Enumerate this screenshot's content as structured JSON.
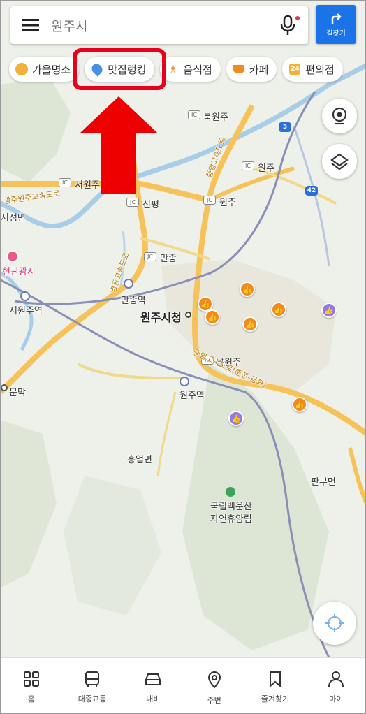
{
  "search": {
    "query": "원주시"
  },
  "directions_label": "길찾기",
  "chips": [
    {
      "label": "가을명소",
      "icon": "autumn-leaf-icon"
    },
    {
      "label": "맛집랭킹",
      "icon": "restaurant-ranking-icon"
    },
    {
      "label": "음식점",
      "icon": "fork-knife-icon"
    },
    {
      "label": "카페",
      "icon": "coffee-cup-icon"
    },
    {
      "label": "편의점",
      "icon": "convenience-store-icon"
    }
  ],
  "map": {
    "labels": {
      "bukwonju": "북원주",
      "wonju_ic": "원주",
      "seowonju": "서원주",
      "sinpyeong": "신평",
      "wonju_jc": "원주",
      "jijeong": "지정면",
      "hyeonkwang": "현관광지",
      "manjong_jc": "만종",
      "manjong_station": "만종역",
      "seowonju_station": "서원주역",
      "city_hall": "원주시청",
      "namwonju": "남원주",
      "munmak": "문막",
      "wonju_station": "원주역",
      "heungeop": "흥업면",
      "panbu": "판부면",
      "park_line1": "국립백운산",
      "park_line2": "자연휴양림",
      "highway_gwangju_wonju": "광주원주고속도로",
      "highway_jungang": "중앙고속도로",
      "highway_yeongdong": "영동고속도로",
      "highway_jungang_south": "중앙고속도로(춘천-금화)",
      "route_5": "5",
      "route_42": "42"
    }
  },
  "nav": [
    {
      "label": "홈",
      "icon": "home-grid-icon"
    },
    {
      "label": "대중교통",
      "icon": "bus-icon"
    },
    {
      "label": "내비",
      "icon": "car-icon"
    },
    {
      "label": "주변",
      "icon": "location-pin-icon"
    },
    {
      "label": "즐겨찾기",
      "icon": "bookmark-icon"
    },
    {
      "label": "마이",
      "icon": "person-icon"
    }
  ],
  "colors": {
    "accent": "#1a73e8",
    "annotation": "#e8001c",
    "highway": "#f6c35a",
    "map_bg": "#eef0ea",
    "restaurant_pin": "#f28a1c",
    "cafe_pin": "#8e7ae8"
  }
}
